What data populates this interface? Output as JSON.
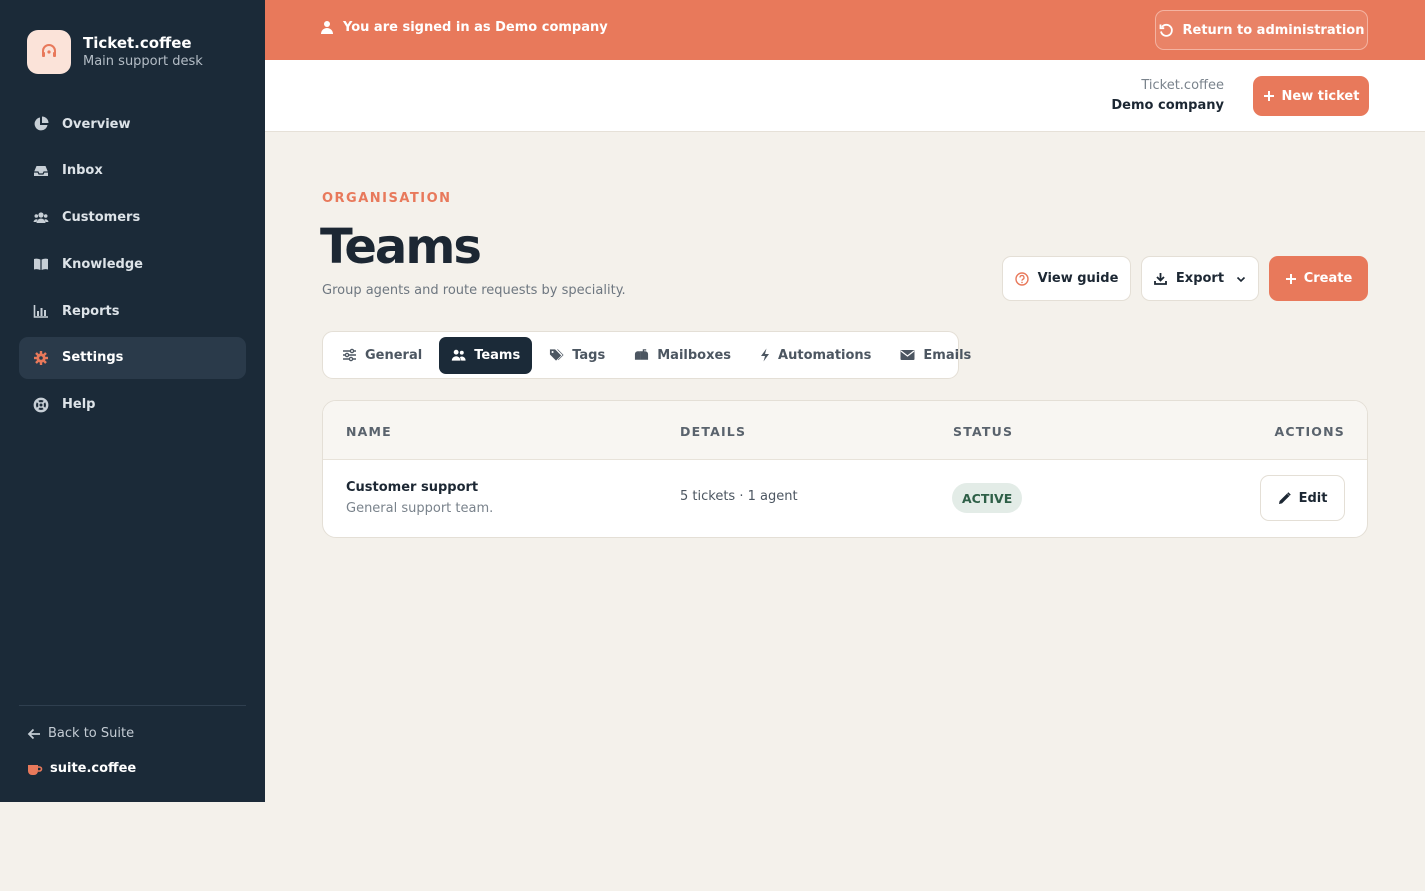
{
  "app": {
    "name": "Ticket.coffee",
    "subtitle": "Main support desk"
  },
  "sidebar": {
    "items": [
      {
        "label": "Overview",
        "icon": "pie-chart-icon"
      },
      {
        "label": "Inbox",
        "icon": "inbox-icon"
      },
      {
        "label": "Customers",
        "icon": "users-icon"
      },
      {
        "label": "Knowledge",
        "icon": "book-icon"
      },
      {
        "label": "Reports",
        "icon": "bar-chart-icon"
      },
      {
        "label": "Settings",
        "icon": "gear-icon",
        "active": true
      },
      {
        "label": "Help",
        "icon": "lifebuoy-icon"
      }
    ],
    "back_label": "Back to Suite",
    "suite_label": "suite.coffee"
  },
  "banner": {
    "message": "You are signed in as Demo company",
    "return_label": "Return to administration"
  },
  "topbar": {
    "account_app": "Ticket.coffee",
    "account_company": "Demo company",
    "new_ticket_label": "New ticket"
  },
  "page": {
    "eyebrow": "ORGANISATION",
    "title": "Teams",
    "subtitle": "Group agents and route requests by speciality.",
    "view_guide_label": "View guide",
    "export_label": "Export",
    "create_label": "Create"
  },
  "tabs": [
    {
      "label": "General",
      "icon": "sliders-icon"
    },
    {
      "label": "Teams",
      "icon": "users-icon",
      "active": true
    },
    {
      "label": "Tags",
      "icon": "tags-icon"
    },
    {
      "label": "Mailboxes",
      "icon": "mailbox-icon"
    },
    {
      "label": "Automations",
      "icon": "bolt-icon"
    },
    {
      "label": "Emails",
      "icon": "envelope-icon"
    }
  ],
  "table": {
    "columns": [
      "NAME",
      "DETAILS",
      "STATUS",
      "ACTIONS"
    ],
    "rows": [
      {
        "name": "Customer support",
        "description": "General support team.",
        "details": "5 tickets · 1 agent",
        "status": "ACTIVE",
        "action_label": "Edit"
      }
    ]
  },
  "colors": {
    "accent": "#e8795b",
    "sidebar_bg": "#1b2a38",
    "page_bg": "#f4f1eb",
    "status_active_bg": "#e3ece7"
  }
}
